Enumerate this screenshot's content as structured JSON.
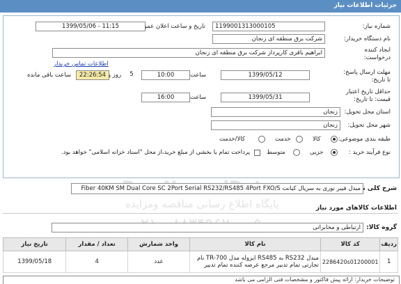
{
  "header": {
    "title": "جزئیات اطلاعات نیاز"
  },
  "form": {
    "need_number_label": "شماره نیاز:",
    "need_number": "1199001313000105",
    "announce_label": "تاریخ و ساعت اعلان عمومی:",
    "announce_value": "1399/05/06 - 11:15",
    "buyer_org_label": "نام دستگاه خریدار:",
    "buyer_org": "شرکت برق منطقه ای زنجان",
    "requester_label": "ایجاد کننده درخواست:",
    "requester": "ابراهیم باقری کارپرداز شرکت برق منطقه ای زنجان",
    "contact_link": "اطلاعات تماس خریدار",
    "deadline_label": "مهلت ارسال پاسخ: تا تاریخ:",
    "deadline_date": "1399/05/12",
    "time_label": "ساعت",
    "deadline_time": "10:00",
    "days_value": "5",
    "days_label": "روز و",
    "remaining_time": "22:26:54",
    "remaining_label": "ساعت باقی مانده",
    "validity_label": "حداقل تاریخ اعتبار قیمت: تا تاریخ:",
    "validity_date": "1399/05/31",
    "validity_time": "16:00",
    "province_label": "استان محل تحویل:",
    "province": "زنجان",
    "city_label": "شهر محل تحویل:",
    "city": "زنجان",
    "category_label": "طبقه بندی موضوعی:",
    "category_options": [
      "کالا",
      "خدمت",
      "کالا/خدمت"
    ],
    "process_label": "نوع فرآیند خرید :",
    "process_options": [
      "جزیی",
      "متوسط"
    ],
    "payment_note": "پرداخت تمام یا بخشی از مبلغ خرید،از محل \"اسناد خزانه اسلامی\" خواهد بود."
  },
  "summary": {
    "label": "شرح کلی نیاز:",
    "value": "مبدل فیبر نوری به سریال کیانت Fiber 40KM SM Dual Core SC 2Port Serial RS232/RS485 4Port FXO/S"
  },
  "goods": {
    "section_title": "اطلاعات کالاهای مورد نیاز",
    "group_label": "گروه کالا:",
    "group_value": "ارتباطی و مخابراتی",
    "columns": [
      "ردیف",
      "کد کالا",
      "نام کالا",
      "واحد شمارش",
      "تعداد / مقدار",
      "تاریخ نیاز"
    ],
    "rows": [
      {
        "row": "1",
        "code": "2286420s01200001",
        "name": "مبدل RS232 به RS485 ایزوله مدل TR-700 نام تجارتی تمام تدبیر مرجع عرضه کننده تمام تدبیر",
        "unit": "عدد",
        "qty": "4",
        "date": "1399/05/18"
      }
    ]
  },
  "footer_note": "توضیحات خریدار: ارائه پیش فاکتور و مشخصات فنی الزامی می باشد",
  "watermark": {
    "brand": "ParsNamadData.com",
    "tagline": "پایگاه اطلاع رسانی مناقصه ومزایده",
    "phone": "۰۲۱ - ۸۸۳۴۹۶۷۰ - ۵"
  }
}
